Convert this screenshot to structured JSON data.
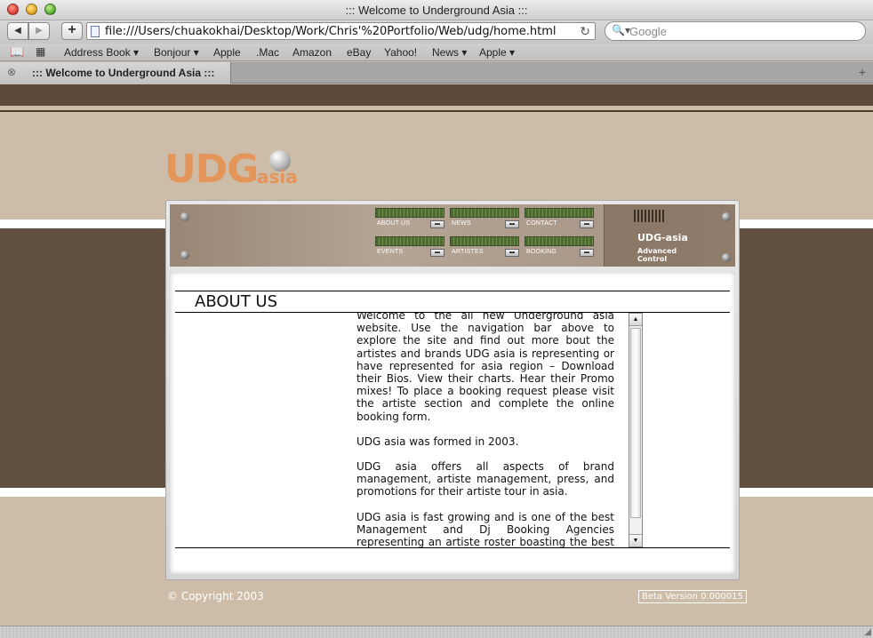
{
  "window": {
    "title": "::: Welcome to Underground Asia :::"
  },
  "toolbar": {
    "url": "file:///Users/chuakokhai/Desktop/Work/Chris'%20Portfolio/Web/udg/home.html",
    "search_placeholder": "Google",
    "back_icon": "◀",
    "forward_icon": "▶",
    "add_icon": "+",
    "reload_icon": "↻",
    "search_icon": "🔍▾"
  },
  "bookmarks": {
    "icons": [
      "book-icon",
      "grid-icon"
    ],
    "items": [
      "Address Book ▾",
      "Bonjour ▾",
      "Apple",
      ".Mac",
      "Amazon",
      "eBay",
      "Yahoo!",
      "News ▾",
      "Apple ▾"
    ]
  },
  "tab": {
    "title": "::: Welcome to Underground Asia :::",
    "close_icon": "⊗",
    "add_icon": "+"
  },
  "site": {
    "logo_main": "UDG",
    "logo_sub": "asia",
    "panel_brand": "UDG-asia",
    "panel_brand_sub_1": "Advanced",
    "panel_brand_sub_2": "Control",
    "nav": [
      "ABOUT US",
      "NEWS",
      "CONTACT",
      "EVENTS",
      "ARTISTES",
      "BOOKING"
    ],
    "dropdown_glyph": "▬",
    "section_title": "ABOUT US",
    "paragraphs": [
      "Welcome to the all new Underground asia website. Use the navigation bar above to explore the site and find out more bout the artistes and brands UDG asia is representing or have represented for asia region – Download their Bios. View their charts. Hear their Promo mixes! To place a booking request please visit the artiste section and complete the online booking form.",
      "UDG asia was formed in 2003.",
      "UDG asia offers all aspects of brand management, artiste management, press, and promotions for their artiste tour in asia.",
      "UDG asia is fast growing and is one of the best Management and Dj Booking Agencies representing an artiste roster boasting the best undeaground talents and brands in asia that is"
    ],
    "scroll_up": "▲",
    "scroll_down": "▼",
    "copyright": "© Copyright 2003",
    "beta": "Beta Version 0.000015"
  },
  "status": {
    "grip": "◢"
  },
  "colors": {
    "accent": "#e4955a",
    "band_dark": "#61503f",
    "page_bg": "#cdbca8"
  }
}
